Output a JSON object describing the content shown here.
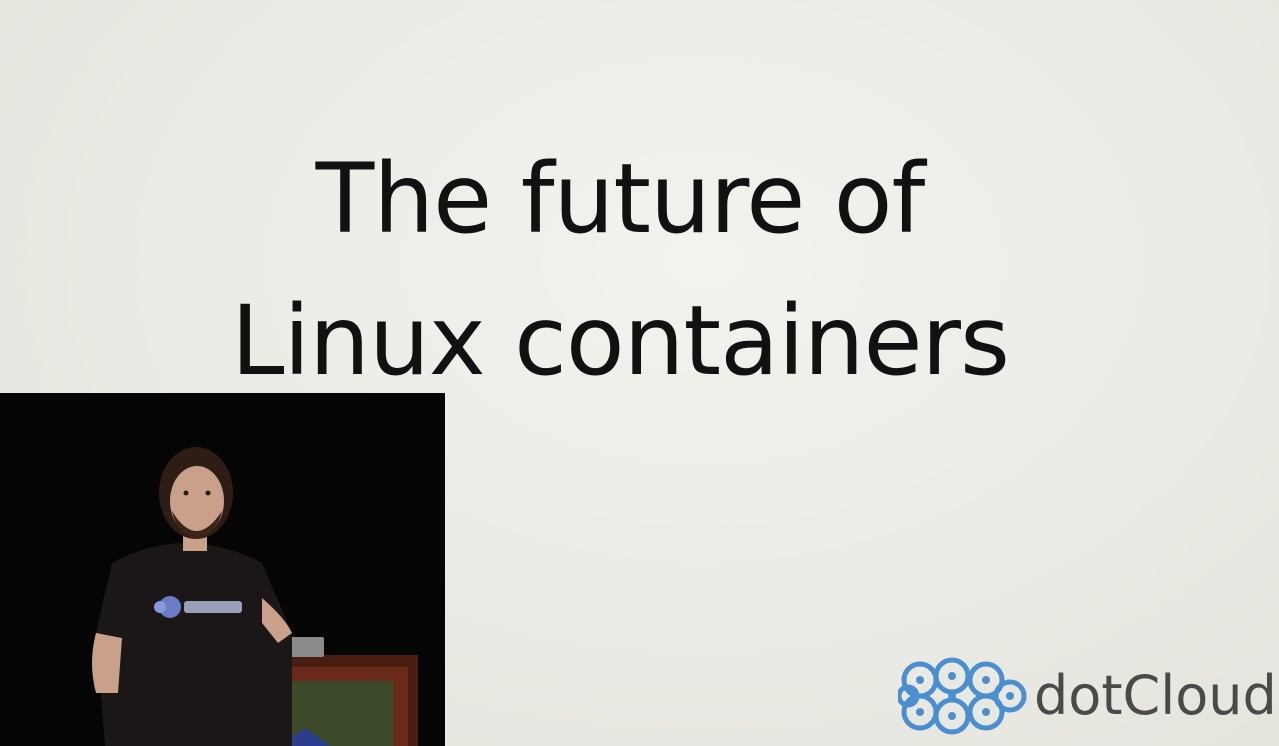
{
  "slide": {
    "title_line1": "The future of",
    "title_line2": "Linux containers"
  },
  "logo": {
    "text": "dotCloud",
    "icon": "dotcloud-logo-icon"
  },
  "speaker_inset": {
    "icon": "speaker-video-icon"
  },
  "colors": {
    "background": "#ecece6",
    "title": "#111111",
    "logo_blue": "#4a8fd0",
    "logo_text": "#4a4a4a",
    "inset_bg": "#050505"
  }
}
